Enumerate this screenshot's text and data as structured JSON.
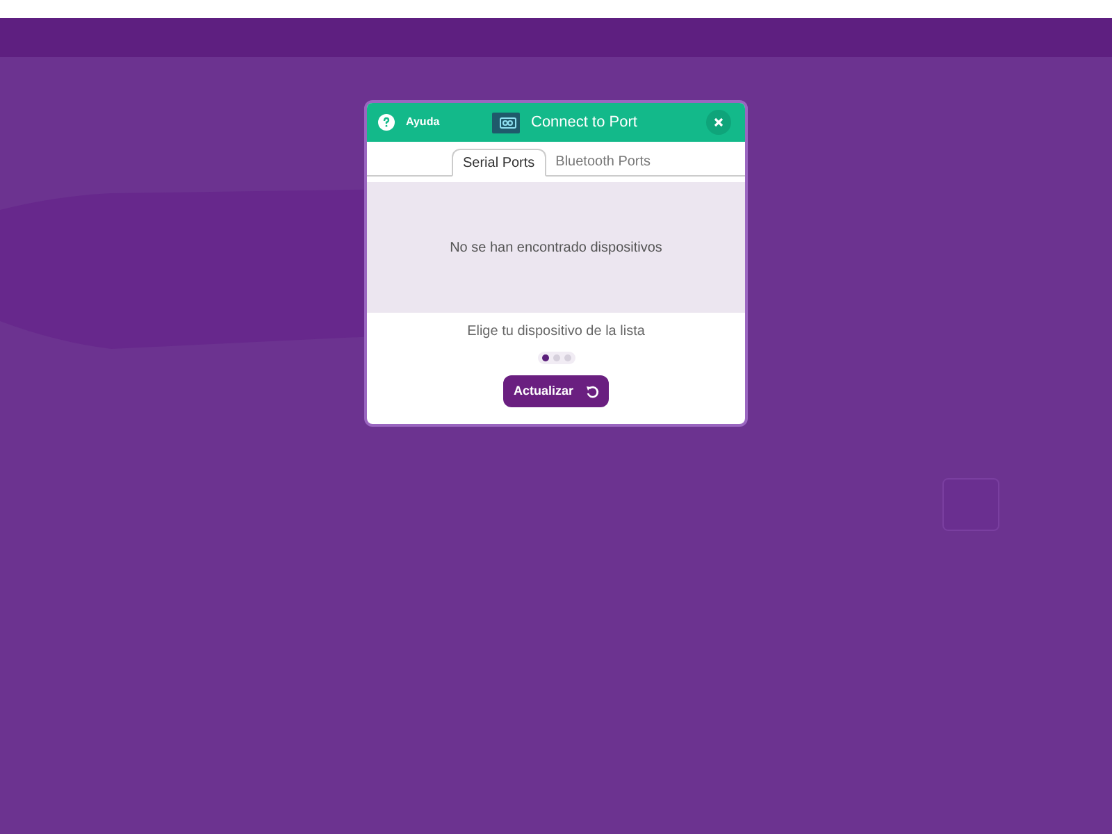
{
  "dialog": {
    "help_label": "Ayuda",
    "title": "Connect to Port",
    "tabs": [
      {
        "label": "Serial Ports",
        "selected": true
      },
      {
        "label": "Bluetooth Ports",
        "selected": false
      }
    ],
    "empty_message": "No se han encontrado dispositivos",
    "hint": "Elige tu dispositivo de la lista",
    "steps": [
      {
        "selected": true
      },
      {
        "selected": false
      },
      {
        "selected": false
      }
    ],
    "refresh_button": "Actualizar"
  }
}
